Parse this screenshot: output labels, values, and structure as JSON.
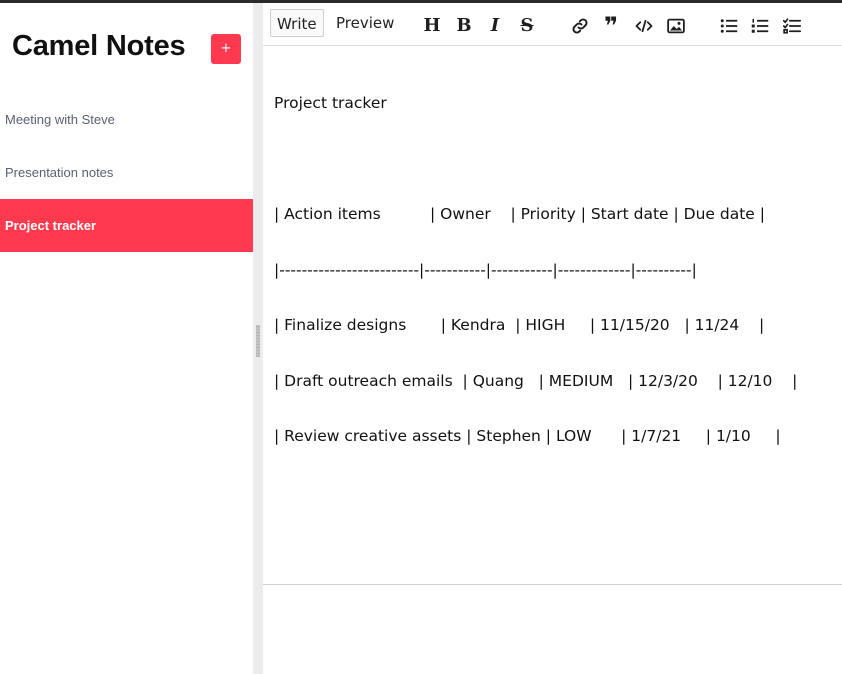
{
  "app": {
    "title": "Camel Notes",
    "add_label": "+"
  },
  "notes": [
    {
      "title": "Meeting with Steve",
      "active": false
    },
    {
      "title": "Presentation notes",
      "active": false
    },
    {
      "title": "Project tracker",
      "active": true
    }
  ],
  "editor": {
    "tabs": {
      "write": "Write",
      "preview": "Preview"
    },
    "toolbar_icons": [
      "heading-icon",
      "bold-icon",
      "italic-icon",
      "strikethrough-icon",
      "link-icon",
      "quote-icon",
      "code-icon",
      "image-icon",
      "unordered-list-icon",
      "ordered-list-icon",
      "checklist-icon"
    ],
    "toolbar_glyphs": {
      "heading": "H",
      "bold": "B",
      "italic": "I",
      "strike": "S",
      "quote": "❞"
    },
    "content_lines": [
      "Project tracker",
      "",
      "| Action items          | Owner    | Priority | Start date | Due date |",
      "|-------------------------|-----------|-----------|-------------|----------|",
      "| Finalize designs       | Kendra  | HIGH     | 11/15/20   | 11/24    |",
      "| Draft outreach emails  | Quang   | MEDIUM   | 12/3/20    | 12/10    |",
      "| Review creative assets | Stephen | LOW      | 1/7/21     | 1/10     |"
    ]
  },
  "colors": {
    "accent": "#ff3a4f",
    "sidebar_text": "#5a5f73",
    "splitter": "#ececec"
  }
}
